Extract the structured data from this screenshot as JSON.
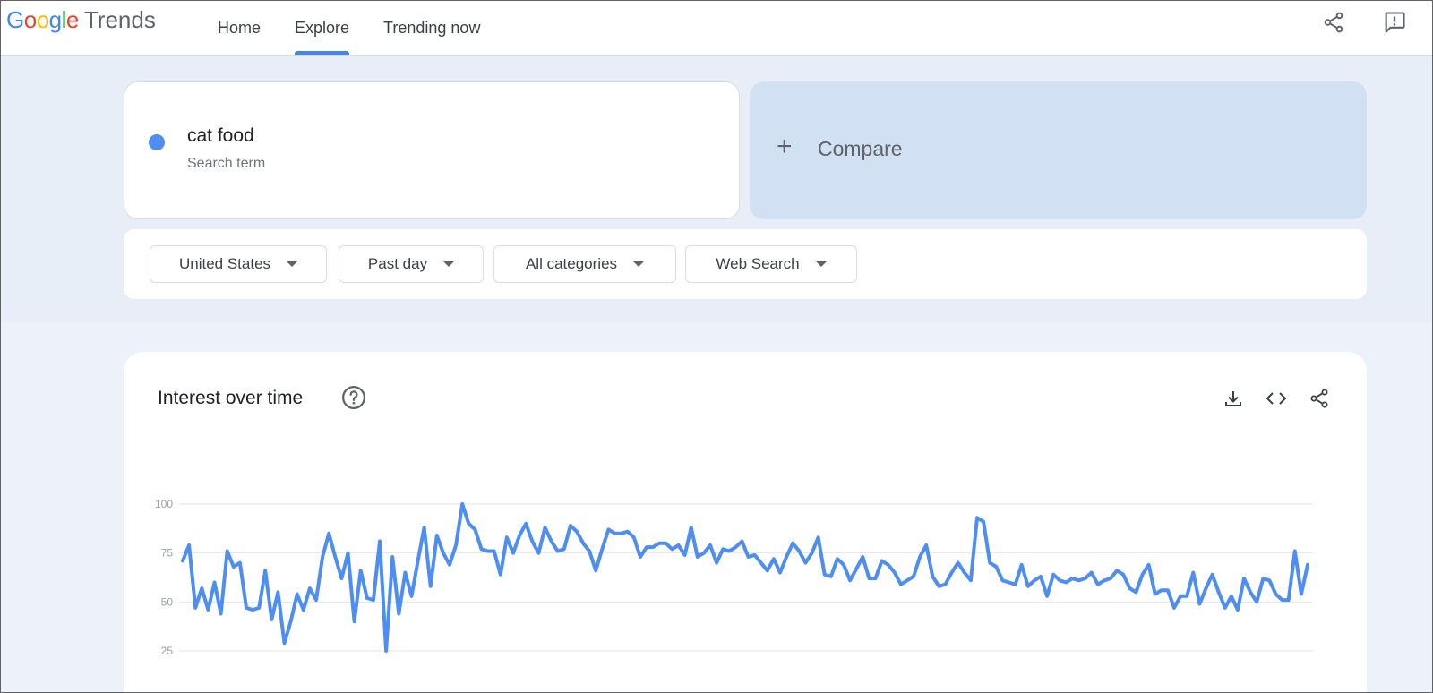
{
  "header": {
    "logo_google": "Google",
    "logo_trends": "Trends",
    "tabs": [
      {
        "label": "Home",
        "active": false
      },
      {
        "label": "Explore",
        "active": true
      },
      {
        "label": "Trending now",
        "active": false
      }
    ],
    "icons": [
      "share-icon",
      "feedback-icon"
    ]
  },
  "search": {
    "term": "cat food",
    "term_type": "Search term",
    "term_color": "#4e8ef2",
    "compare_label": "Compare"
  },
  "filters": {
    "region": "United States",
    "time": "Past day",
    "category": "All categories",
    "property": "Web Search"
  },
  "chart_panel": {
    "title": "Interest over time",
    "icons": [
      "help-icon",
      "download-icon",
      "embed-icon",
      "share-icon"
    ]
  },
  "chart_data": {
    "type": "line",
    "title": "Interest over time",
    "xlabel": "",
    "ylabel": "",
    "ylim": [
      0,
      100
    ],
    "y_ticks": [
      25,
      50,
      75,
      100
    ],
    "grid": true,
    "line_color": "#4e8ef2",
    "series": [
      {
        "values": [
          71,
          79,
          47,
          57,
          46,
          60,
          44,
          76,
          68,
          70,
          47,
          46,
          47,
          66,
          41,
          55,
          29,
          40,
          54,
          46,
          57,
          51,
          73,
          85,
          73,
          62,
          75,
          40,
          66,
          52,
          51,
          81,
          25,
          73,
          44,
          65,
          53,
          71,
          88,
          58,
          84,
          75,
          69,
          79,
          100,
          90,
          87,
          77,
          76,
          76,
          64,
          83,
          75,
          84,
          90,
          81,
          75,
          88,
          81,
          76,
          77,
          89,
          86,
          80,
          76,
          66,
          77,
          87,
          85,
          85,
          86,
          83,
          73,
          78,
          78,
          80,
          80,
          77,
          79,
          74,
          88,
          73,
          75,
          79,
          70,
          77,
          76,
          78,
          81,
          73,
          74,
          70,
          66,
          72,
          65,
          73,
          80,
          76,
          70,
          75,
          83,
          64,
          63,
          72,
          69,
          61,
          67,
          73,
          62,
          62,
          71,
          69,
          65,
          59,
          61,
          63,
          73,
          79,
          63,
          58,
          59,
          65,
          70,
          65,
          61,
          93,
          91,
          70,
          68,
          61,
          60,
          59,
          69,
          58,
          61,
          63,
          53,
          64,
          61,
          60,
          62,
          61,
          62,
          65,
          59,
          61,
          62,
          66,
          64,
          57,
          55,
          64,
          69,
          54,
          56,
          56,
          47,
          53,
          53,
          65,
          49,
          57,
          64,
          55,
          47,
          53,
          46,
          62,
          55,
          50,
          62,
          61,
          54,
          51,
          51,
          76,
          54,
          69
        ]
      }
    ]
  }
}
